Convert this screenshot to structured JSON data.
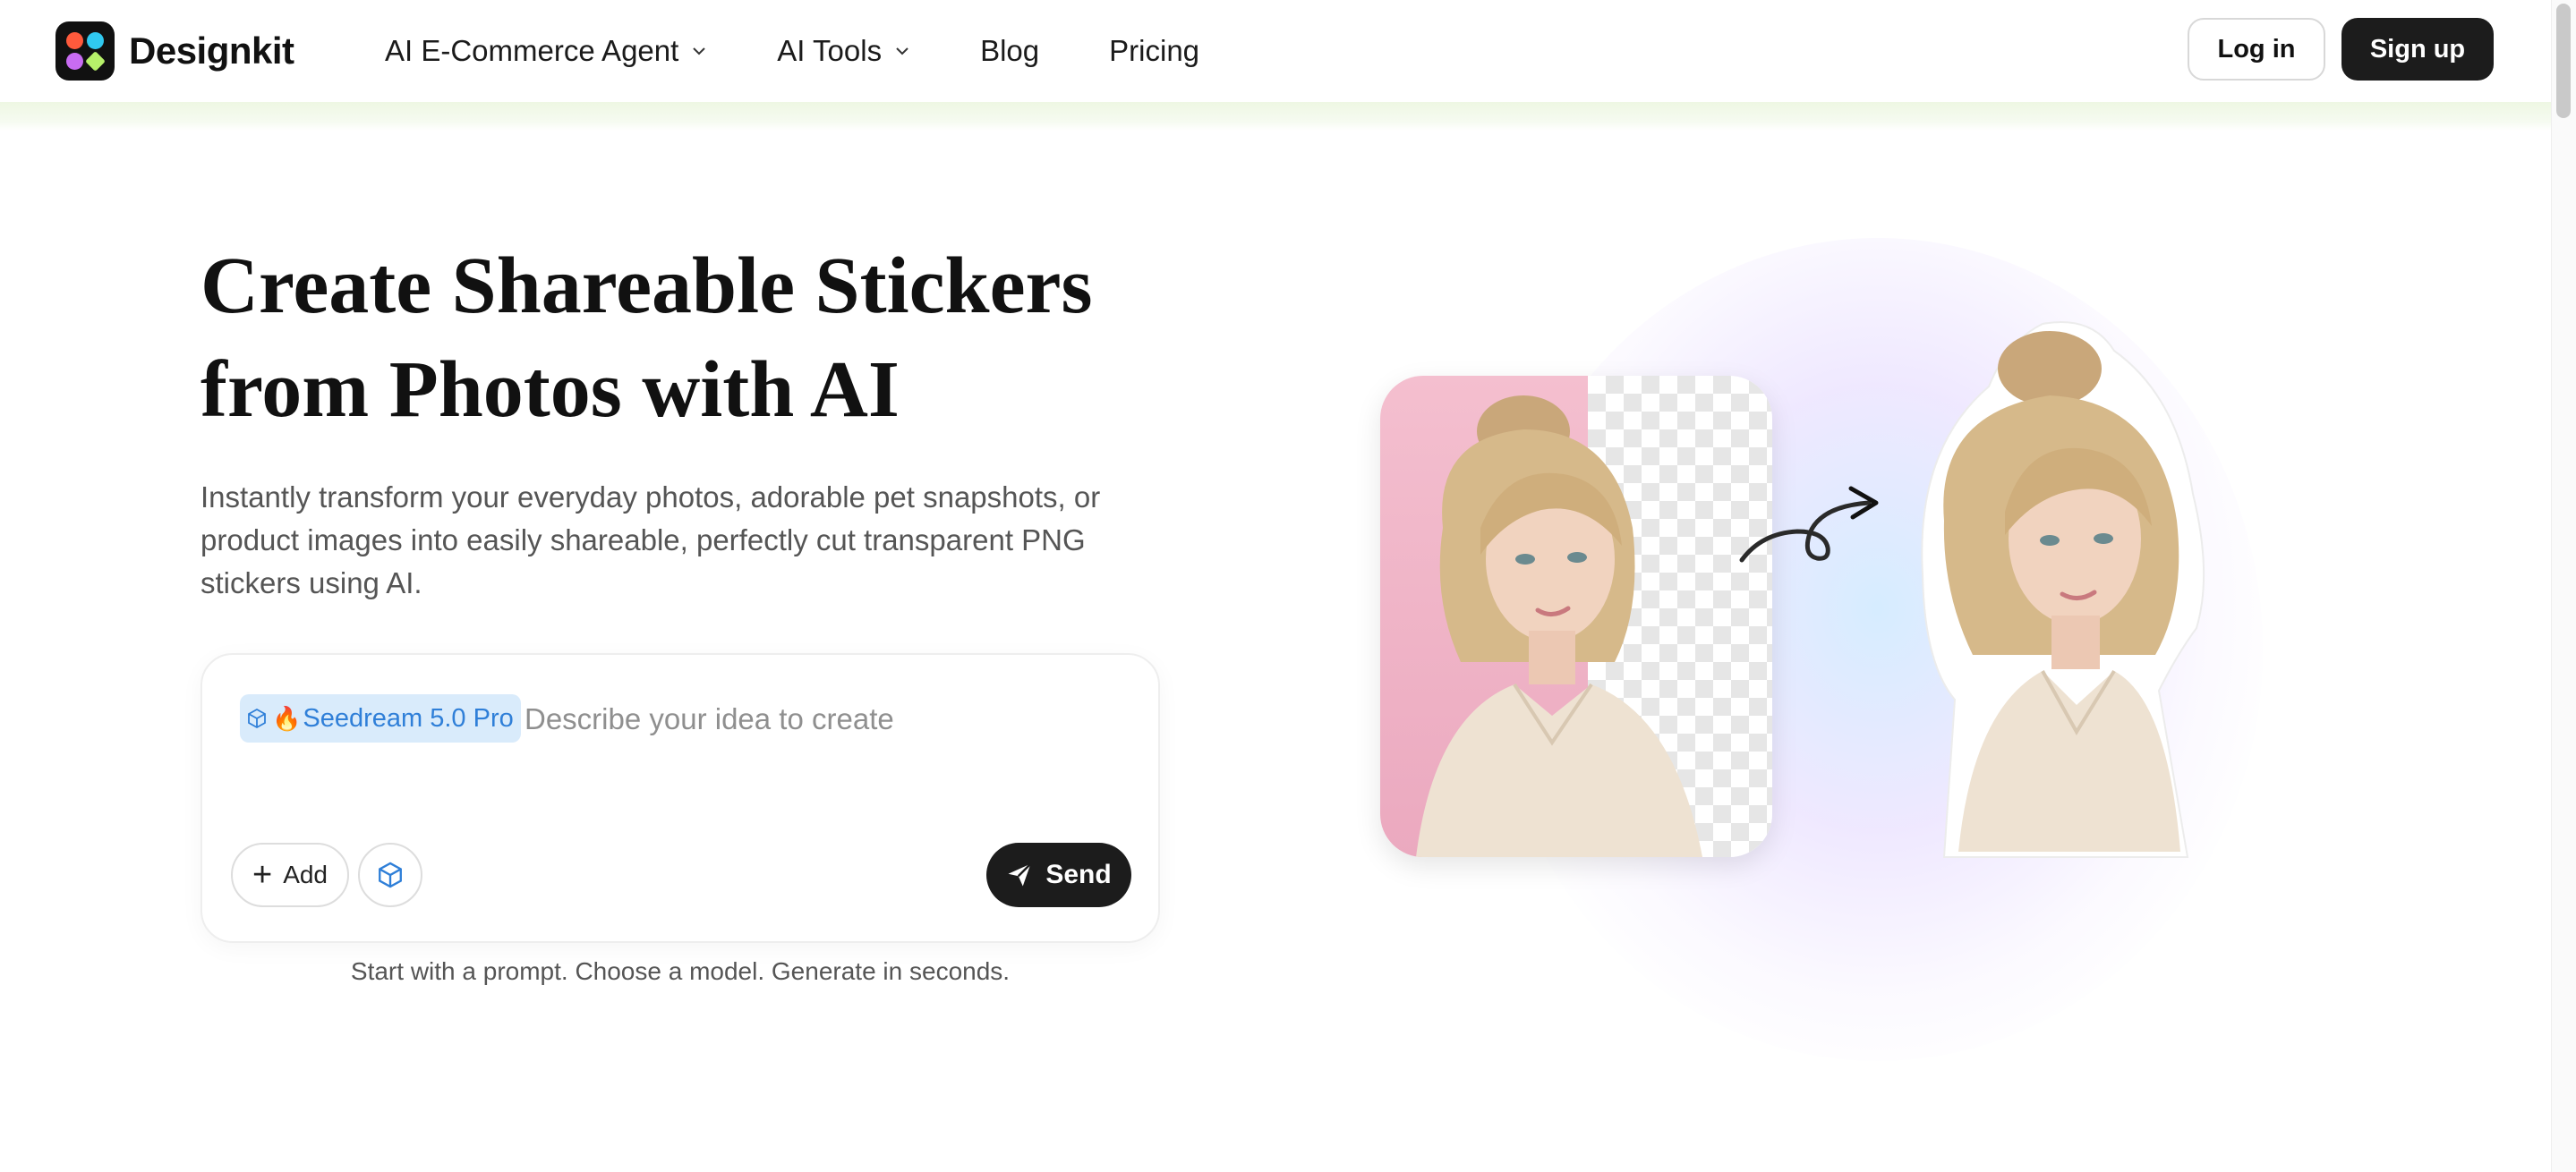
{
  "brand": {
    "name": "Designkit"
  },
  "nav": {
    "items": [
      {
        "label": "AI E-Commerce Agent",
        "has_dropdown": true
      },
      {
        "label": "AI Tools",
        "has_dropdown": true
      },
      {
        "label": "Blog",
        "has_dropdown": false
      },
      {
        "label": "Pricing",
        "has_dropdown": false
      }
    ]
  },
  "auth": {
    "login_label": "Log in",
    "signup_label": "Sign up"
  },
  "hero": {
    "title_line1": "Create Shareable Stickers",
    "title_line2": "from Photos with AI",
    "description": "Instantly transform your everyday photos, adorable pet snapshots, or product images into easily shareable, perfectly cut transparent PNG stickers using AI."
  },
  "prompt": {
    "model_chip": "Seedream 5.0 Pro",
    "model_chip_emoji": "🔥",
    "placeholder": "Describe your idea to create",
    "add_label": "Add",
    "send_label": "Send",
    "caption": "Start with a prompt. Choose a model. Generate in seconds."
  },
  "colors": {
    "primary_dark": "#1c1c1c",
    "chip_bg": "#d9ebfb",
    "chip_text": "#2f7fd8",
    "header_band": "#eef7e3"
  }
}
